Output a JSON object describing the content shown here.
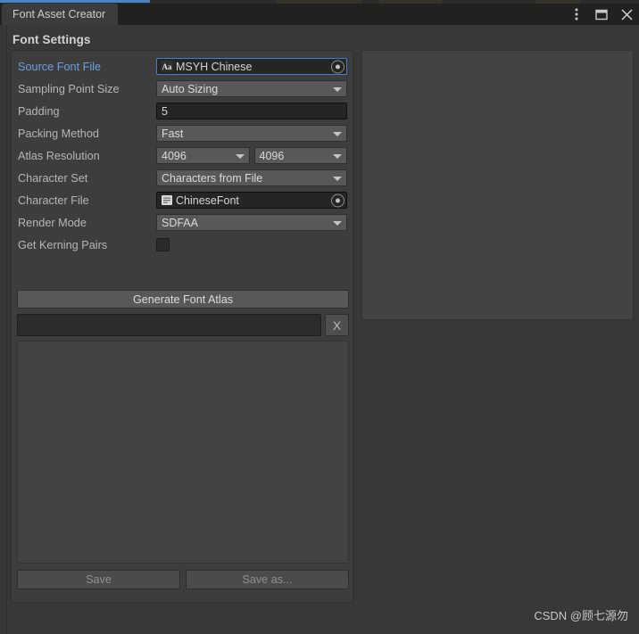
{
  "window": {
    "tab_label": "Font Asset Creator",
    "controls": [
      {
        "name": "more-options",
        "glyph": "⋮"
      },
      {
        "name": "maximize",
        "glyph": "☐"
      },
      {
        "name": "close",
        "glyph": "✕"
      }
    ],
    "accent_color": "#4a84c4"
  },
  "section": {
    "title": "Font Settings"
  },
  "settings": {
    "source_font_file": {
      "label": "Source Font File",
      "value": "MSYH Chinese",
      "icon": "font-asset-icon",
      "modified": true,
      "focused": true
    },
    "sampling_point_size": {
      "label": "Sampling Point Size",
      "value": "Auto Sizing"
    },
    "padding": {
      "label": "Padding",
      "value": "5"
    },
    "packing_method": {
      "label": "Packing Method",
      "value": "Fast"
    },
    "atlas_resolution": {
      "label": "Atlas Resolution",
      "width": "4096",
      "height": "4096"
    },
    "character_set": {
      "label": "Character Set",
      "value": "Characters from File"
    },
    "character_file": {
      "label": "Character File",
      "value": "ChineseFont",
      "icon": "text-asset-icon"
    },
    "render_mode": {
      "label": "Render Mode",
      "value": "SDFAA"
    },
    "get_kerning_pairs": {
      "label": "Get Kerning Pairs",
      "checked": false
    }
  },
  "actions": {
    "generate_label": "Generate Font Atlas",
    "cancel_label": "X",
    "progress_value": "",
    "save_label": "Save",
    "save_as_label": "Save as..."
  },
  "watermark": {
    "text": "CSDN @顾七源勿"
  }
}
